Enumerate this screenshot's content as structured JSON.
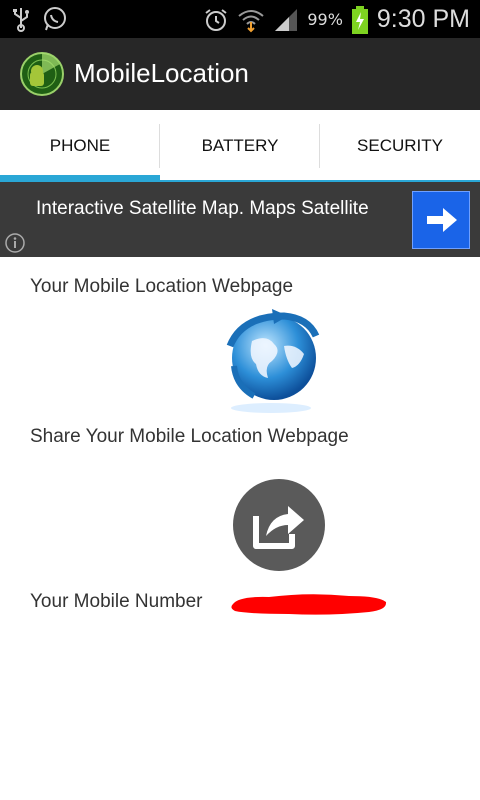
{
  "status_bar": {
    "battery": "99%",
    "time": "9:30 PM"
  },
  "app": {
    "title": "MobileLocation"
  },
  "tabs": [
    {
      "label": "PHONE",
      "active": true
    },
    {
      "label": "BATTERY",
      "active": false
    },
    {
      "label": "SECURITY",
      "active": false
    }
  ],
  "ad": {
    "text": "Interactive Satellite Map. Maps Satellite"
  },
  "main": {
    "webpage_label": "Your Mobile Location Webpage",
    "share_label": "Share Your Mobile Location Webpage",
    "number_label": "Your Mobile Number"
  },
  "colors": {
    "accent": "#2aa7d6",
    "ad_button": "#1a64e8",
    "redaction": "#ff0000"
  }
}
